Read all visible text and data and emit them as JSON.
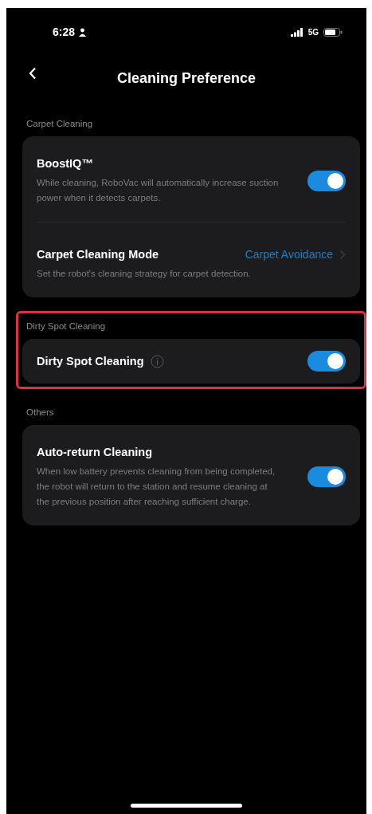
{
  "status_bar": {
    "time": "6:28",
    "network": "5G"
  },
  "header": {
    "title": "Cleaning Preference"
  },
  "sections": [
    {
      "label": "Carpet Cleaning",
      "highlighted": false,
      "rows": [
        {
          "kind": "toggle",
          "title": "BoostIQ™",
          "description": "While cleaning, RoboVac will automatically increase suction power when it detects carpets.",
          "on": true
        },
        {
          "kind": "link",
          "title": "Carpet Cleaning Mode",
          "value": "Carpet Avoidance",
          "description": "Set the robot's cleaning strategy for carpet detection."
        }
      ]
    },
    {
      "label": "Dirty Spot Cleaning",
      "highlighted": true,
      "rows": [
        {
          "kind": "toggle",
          "title": "Dirty Spot Cleaning",
          "info": true,
          "on": true
        }
      ]
    },
    {
      "label": "Others",
      "highlighted": false,
      "rows": [
        {
          "kind": "toggle",
          "title": "Auto-return Cleaning",
          "description": "When low battery prevents cleaning from being completed, the robot will return to the station and resume cleaning at the previous position after reaching sufficient charge.",
          "on": true
        }
      ]
    }
  ]
}
